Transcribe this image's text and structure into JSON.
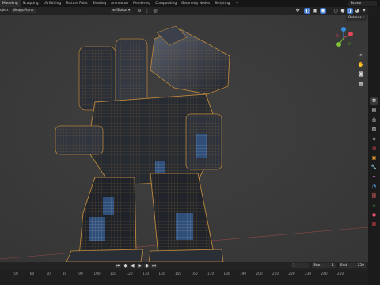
{
  "topbar": {
    "workspaces": [
      "Modeling",
      "Sculpting",
      "UV Editing",
      "Texture Paint",
      "Shading",
      "Animation",
      "Rendering",
      "Compositing",
      "Geometry Nodes",
      "Scripting"
    ],
    "active_index": 0,
    "add_label": "+",
    "scene": "Scene"
  },
  "header": {
    "object_prefix": "oject",
    "object_name": "WeapoPlane",
    "transform_orientation": "Global",
    "options_label": "Options"
  },
  "timeline": {
    "current_frame": "1",
    "start_label": "Start",
    "start": "1",
    "end_label": "End",
    "end": "250",
    "ticks": [
      "50",
      "60",
      "70",
      "80",
      "90",
      "100",
      "110",
      "120",
      "130",
      "140",
      "150",
      "160",
      "170",
      "180",
      "190",
      "200",
      "210",
      "220",
      "230",
      "240",
      "250"
    ]
  },
  "colors": {
    "viewport_bg": "#3a3a3a",
    "accent_blue": "#4a7fd0",
    "gizmo_x": "#e3475b",
    "gizmo_y": "#80c13a",
    "gizmo_z": "#3b8bdc"
  },
  "icons": [
    "cursor-icon",
    "move-icon",
    "view-icon",
    "camera-icon",
    "hand-icon",
    "zoom-icon",
    "grid-icon",
    "shading-solid-icon",
    "shading-material-icon",
    "shading-rendered-icon",
    "play-icon",
    "jump-start-icon",
    "jump-end-icon",
    "keyframe-prev-icon",
    "keyframe-next-icon"
  ]
}
